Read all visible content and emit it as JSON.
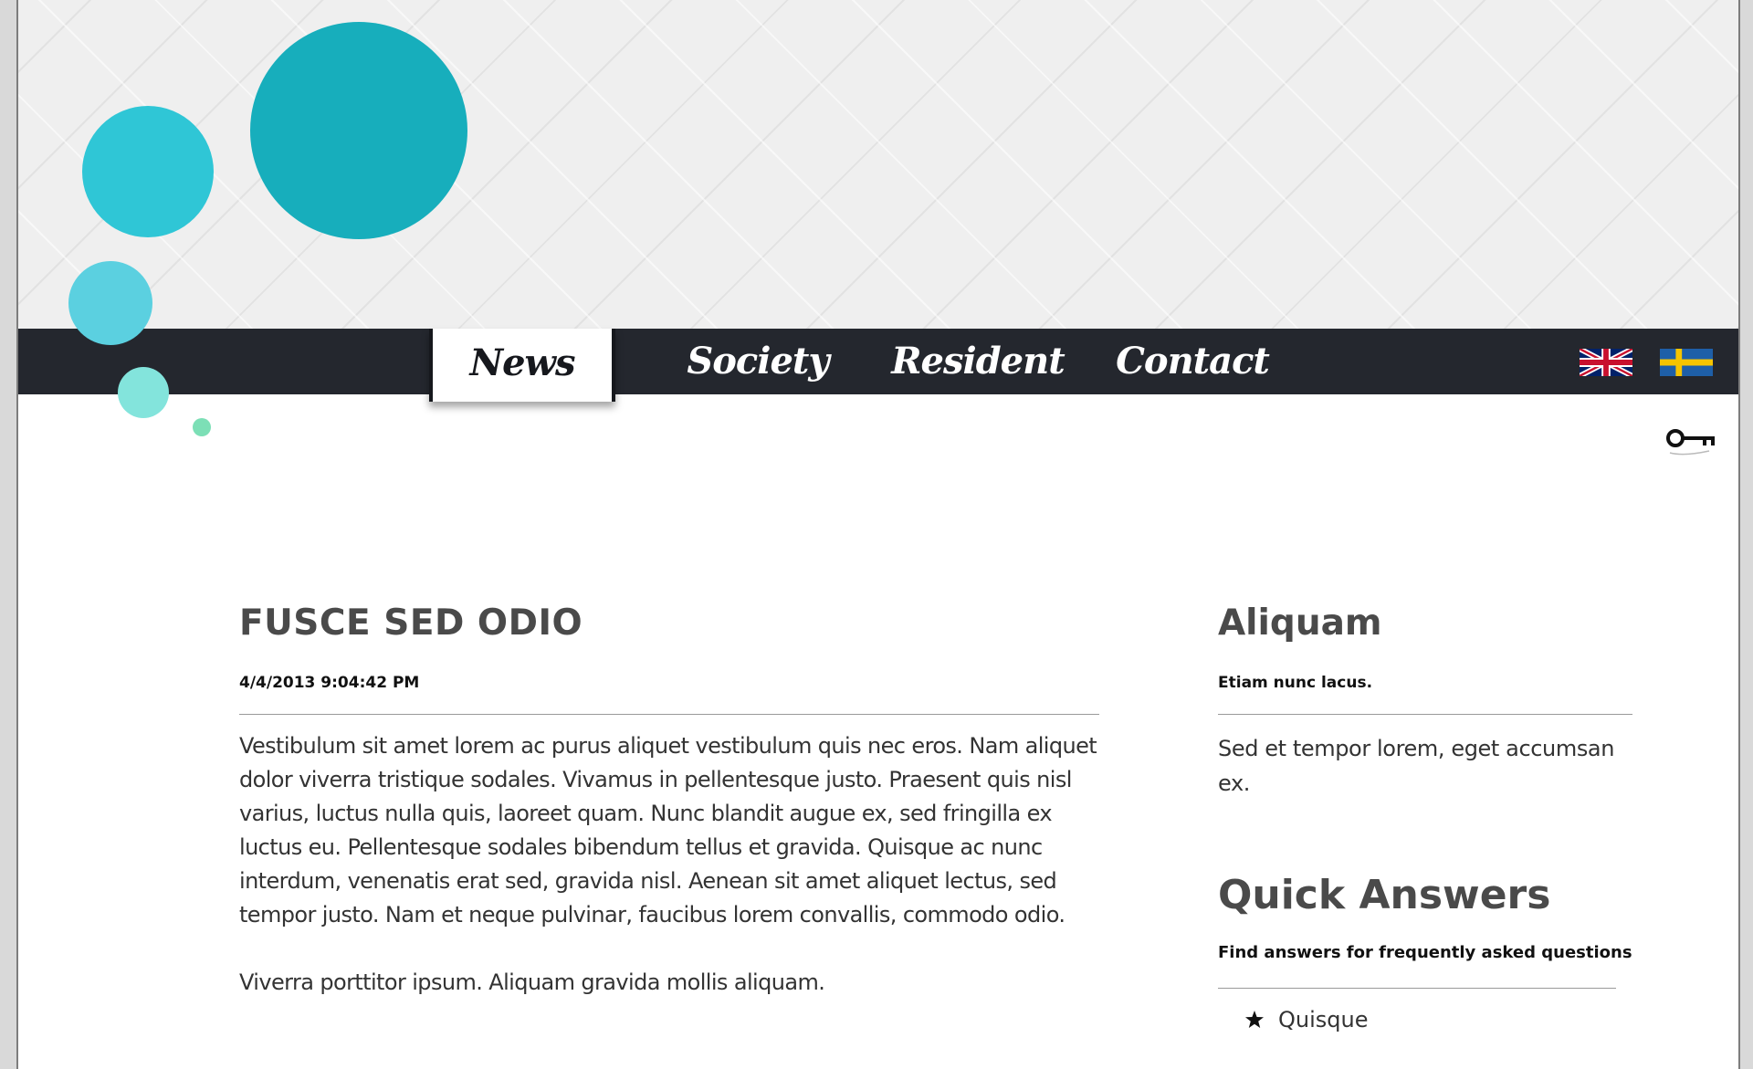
{
  "nav": {
    "items": [
      {
        "label": "News",
        "active": true
      },
      {
        "label": "Society",
        "active": false
      },
      {
        "label": "Resident",
        "active": false
      },
      {
        "label": "Contact",
        "active": false
      }
    ]
  },
  "languages": [
    {
      "icon": "uk-flag-icon",
      "label": "English"
    },
    {
      "icon": "sweden-flag-icon",
      "label": "Swedish"
    }
  ],
  "login": {
    "icon": "key-icon"
  },
  "article": {
    "title": "FUSCE SED ODIO",
    "date": "4/4/2013 9:04:42 PM",
    "paragraphs": [
      "Vestibulum sit amet lorem ac purus aliquet vestibulum quis nec eros. Nam aliquet dolor viverra tristique sodales. Vivamus in pellentesque justo. Praesent quis nisl varius, luctus nulla quis, laoreet quam. Nunc blandit augue ex, sed fringilla ex luctus eu. Pellentesque sodales bibendum tellus et gravida. Quisque ac nunc interdum, venenatis erat sed, gravida nisl. Aenean sit amet aliquet lectus, sed tempor justo. Nam et neque pulvinar, faucibus lorem convallis, commodo odio.",
      "Viverra porttitor ipsum. Aliquam gravida mollis aliquam."
    ]
  },
  "sidebar": {
    "title": "Aliquam",
    "subtitle": "Etiam nunc lacus.",
    "text": "Sed et tempor lorem, eget accumsan ex.",
    "quick_answers": {
      "title": "Quick Answers",
      "subtitle": "Find answers for frequently asked questions",
      "items": [
        "Quisque"
      ]
    }
  },
  "colors": {
    "navbar": "#24272e",
    "bubble_teal_dark": "#17aebc",
    "bubble_teal": "#2fc6d6",
    "bubble_light": "#5bd0e0",
    "bubble_mint": "#83e4dc",
    "bubble_green": "#7cdfb6"
  }
}
